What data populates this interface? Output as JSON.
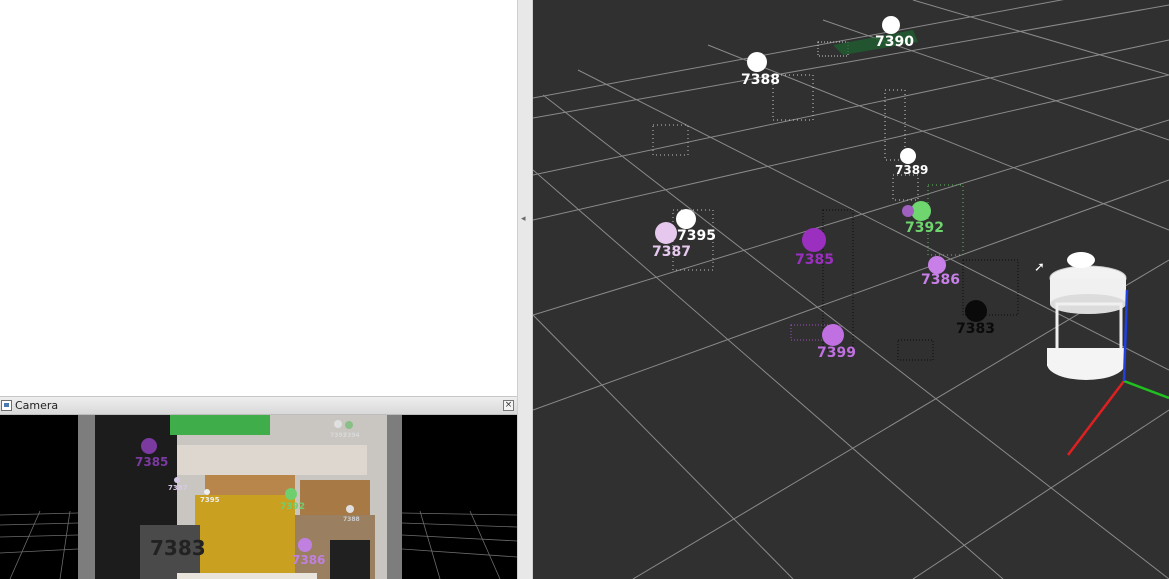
{
  "camera_panel": {
    "title": "Camera",
    "close_glyph": "×",
    "icon": "camera-window-icon",
    "labels": [
      {
        "id": "c7385",
        "text": "7385",
        "color": "#7a3aa0"
      },
      {
        "id": "c7387",
        "text": "7387",
        "color": "#d8c8e8"
      },
      {
        "id": "c7395",
        "text": "7395",
        "color": "#e8e8e8"
      },
      {
        "id": "c7392",
        "text": "7392",
        "color": "#6fcf6f"
      },
      {
        "id": "c7386",
        "text": "7386",
        "color": "#c080e0"
      },
      {
        "id": "c7393",
        "text": "7393",
        "color": "#d0d0d0"
      },
      {
        "id": "c7394",
        "text": "7394",
        "color": "#d0d0d0"
      },
      {
        "id": "c7383",
        "text": "7383",
        "color": "#222222"
      },
      {
        "id": "c7388",
        "text": "7388",
        "color": "#cccccc"
      }
    ]
  },
  "viewport_3d": {
    "background_color": "#303030",
    "grid_color": "#8a8a8a",
    "axis_colors": {
      "x": "#e02020",
      "y": "#20c020",
      "z": "#2040e0"
    },
    "markers": [
      {
        "id": "m7390",
        "text": "7390",
        "color": "#ffffff"
      },
      {
        "id": "m7388",
        "text": "7388",
        "color": "#ffffff"
      },
      {
        "id": "m7389",
        "text": "7389",
        "color": "#ffffff"
      },
      {
        "id": "m7395",
        "text": "7395",
        "color": "#ffffff"
      },
      {
        "id": "m7387",
        "text": "7387",
        "color": "#e6c8ee"
      },
      {
        "id": "m7385",
        "text": "7385",
        "color": "#9b30c0"
      },
      {
        "id": "m7392",
        "text": "7392",
        "color": "#6fd66f"
      },
      {
        "id": "m7386",
        "text": "7386",
        "color": "#c880e8"
      },
      {
        "id": "m7383",
        "text": "7383",
        "color": "#0a0a0a"
      },
      {
        "id": "m7399",
        "text": "7399",
        "color": "#c070e0"
      }
    ]
  }
}
